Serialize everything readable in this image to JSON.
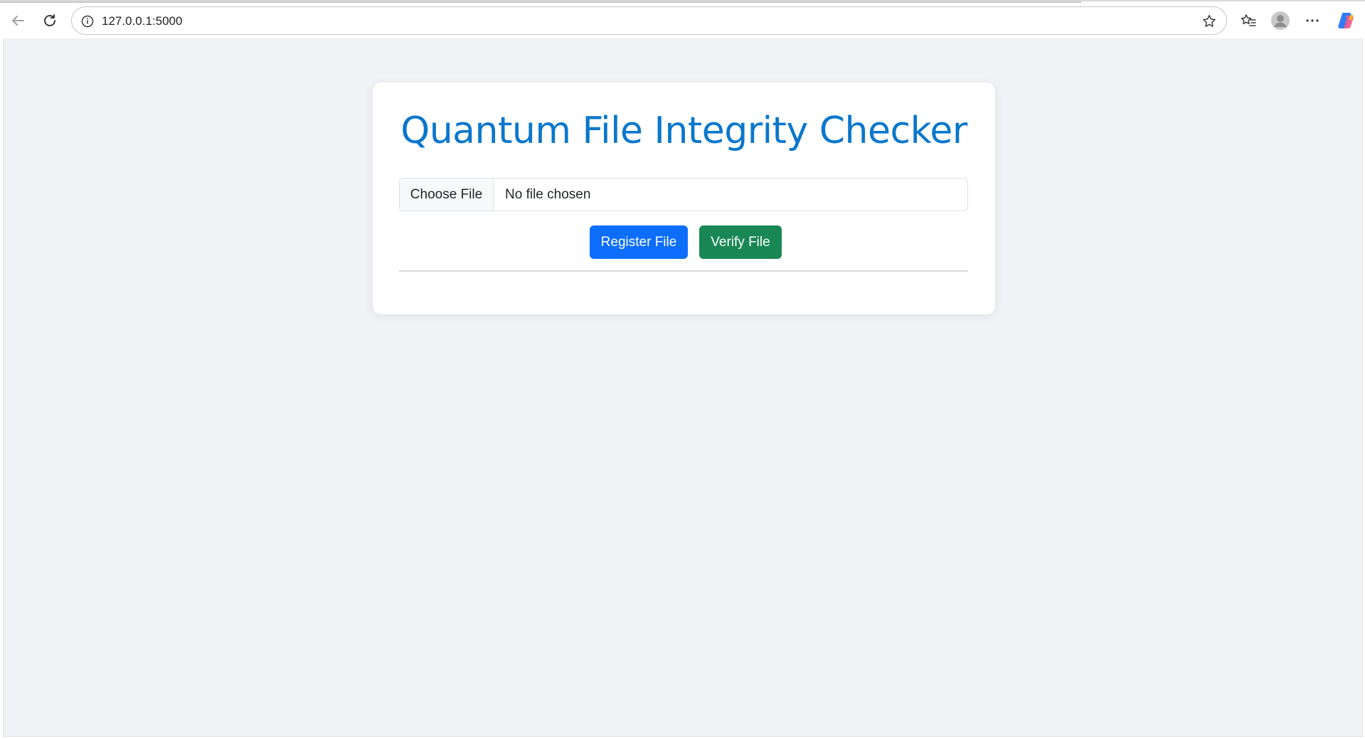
{
  "browser": {
    "url": "127.0.0.1:5000",
    "icons": [
      "back-arrow-icon",
      "reload-icon",
      "site-info-icon",
      "star-icon",
      "favorites-icon",
      "profile-icon",
      "more-icon",
      "copilot-icon"
    ]
  },
  "page": {
    "title": "Quantum File Integrity Checker",
    "file_input": {
      "button_label": "Choose File",
      "status": "No file chosen"
    },
    "buttons": {
      "register": "Register File",
      "verify": "Verify File"
    }
  },
  "colors": {
    "title": "#0a77cc",
    "register_button": "#0d6efd",
    "verify_button": "#198754",
    "page_background": "#f0f2f5"
  }
}
